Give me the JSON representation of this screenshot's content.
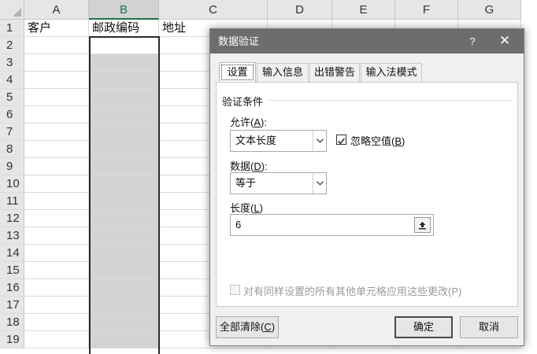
{
  "sheet": {
    "columns": [
      "A",
      "B",
      "C",
      "D",
      "E",
      "F",
      "G"
    ],
    "rows": [
      "1",
      "2",
      "3",
      "4",
      "5",
      "6",
      "7",
      "8",
      "9",
      "10",
      "11",
      "12",
      "13",
      "14",
      "15",
      "16",
      "17",
      "18",
      "19"
    ],
    "header_row": {
      "A": "客户",
      "B": "邮政编码",
      "C": "地址"
    },
    "selected_column": "B",
    "selection_fill_color": "#d3d3d3",
    "header_accent_color": "#217346"
  },
  "dialog": {
    "title": "数据验证",
    "help_label": "?",
    "close_label": "✕",
    "tabs": [
      {
        "label": "设置",
        "active": true
      },
      {
        "label": "输入信息",
        "active": false
      },
      {
        "label": "出错警告",
        "active": false
      },
      {
        "label": "输入法模式",
        "active": false
      }
    ],
    "criteria_group_title": "验证条件",
    "allow": {
      "label": "允许",
      "hotkey": "A",
      "value": "文本长度"
    },
    "ignore_blank": {
      "label": "忽略空值",
      "hotkey": "B",
      "checked": true
    },
    "data": {
      "label": "数据",
      "hotkey": "D",
      "value": "等于"
    },
    "length": {
      "label": "长度",
      "hotkey": "L",
      "value": "6"
    },
    "apply_all": {
      "label": "对有同样设置的所有其他单元格应用这些更改(P)",
      "checked": false,
      "enabled": false
    },
    "clear_all": {
      "label": "全部清除",
      "hotkey": "C"
    },
    "ok_label": "确定",
    "cancel_label": "取消",
    "titlebar_color": "#6d6d6d"
  }
}
